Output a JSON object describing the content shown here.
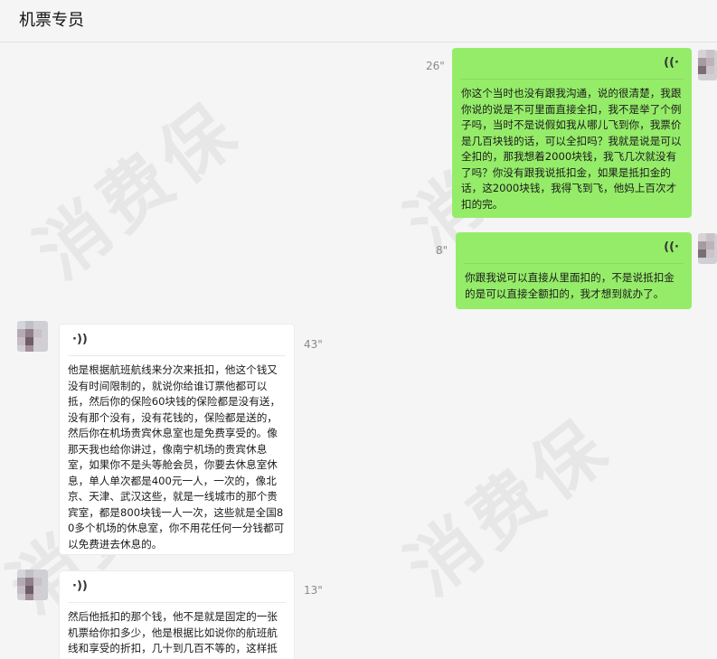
{
  "header": {
    "title": "机票专员"
  },
  "watermark_text": "消费保",
  "colors": {
    "sent_bubble": "#95ec69",
    "received_bubble": "#ffffff",
    "background": "#f5f5f5"
  },
  "messages": [
    {
      "direction": "sent",
      "duration": "26\"",
      "voice_icon": "voice-wave-icon",
      "text": "你这个当时也没有跟我沟通，说的很清楚，我跟你说的说是不可里面直接全扣，我不是举了个例子吗，当时不是说假如我从哪儿飞到你，我票价是几百块钱的话，可以全扣吗？我就是说是可以全扣的，那我想着2000块钱，我飞几次就没有了吗？你没有跟我说抵扣金，如果是抵扣金的话，这2000块钱，我得飞到飞，他妈上百次才扣的完。"
    },
    {
      "direction": "sent",
      "duration": "8\"",
      "voice_icon": "voice-wave-icon",
      "text": "你跟我说可以直接从里面扣的，不是说抵扣金的是可以直接全额扣的，我才想到就办了。"
    },
    {
      "direction": "received",
      "duration": "43\"",
      "voice_icon": "voice-wave-icon",
      "text": "他是根据航班航线来分次来抵扣，他这个钱又没有时间限制的，就说你给谁订票他都可以抵，然后你的保险60块钱的保险都是没有送，没有那个没有，没有花钱的，保险都是送的，然后你在机场贵宾休息室也是免费享受的。像那天我也给你讲过，像南宁机场的贵宾休息室，如果你不是头等舱会员，你要去休息室休息，单人单次都是400元一人，一次的，像北京、天津、武汉这些，就是一线城市的那个贵宾室，都是800块钱一人一次，这些就是全国80多个机场的休息室，你不用花任何一分钱都可以免费进去休息的。"
    },
    {
      "direction": "received",
      "duration": "13\"",
      "voice_icon": "voice-wave-icon",
      "text": "然后他抵扣的那个钱，他不是就是固定的一张机票给你扣多少，他是根据比如说你的航班航线和享受的折扣，几十到几百不等的，这样抵"
    }
  ]
}
